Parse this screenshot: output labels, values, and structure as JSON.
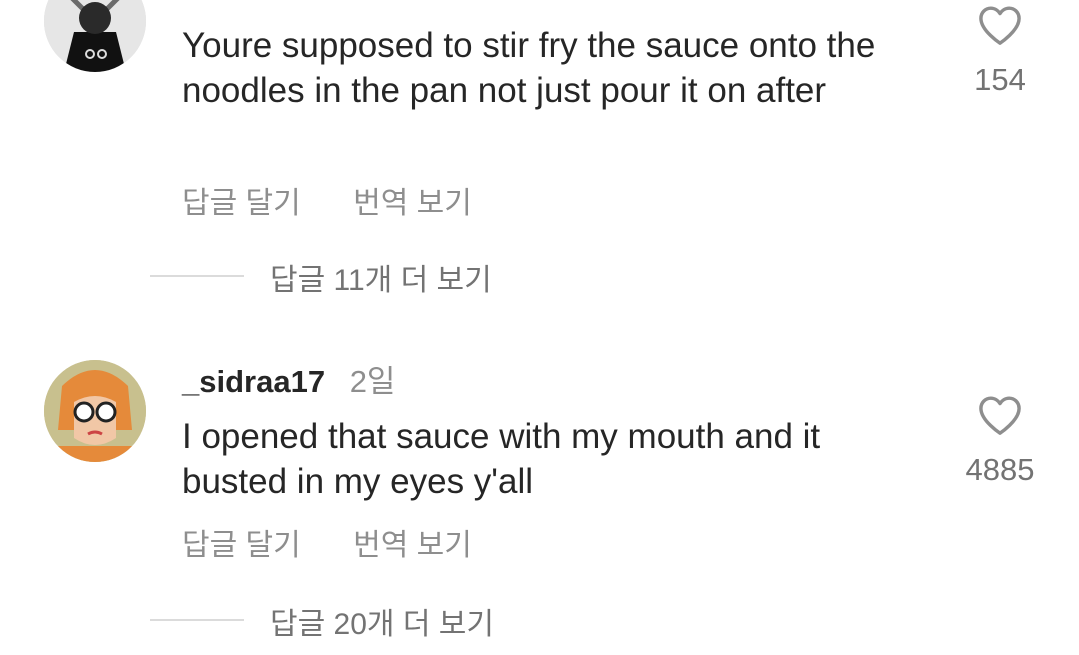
{
  "comments": [
    {
      "username": "",
      "time": "",
      "text": "Youre supposed to stir fry the sauce onto the noodles in the pan not just pour it on after",
      "likes": "154",
      "reply_label": "답글 달기",
      "translate_label": "번역 보기",
      "more_replies_label": "답글 11개 더 보기"
    },
    {
      "username": "_sidraa17",
      "time": "2일",
      "text": "I opened that sauce with my mouth and it busted in my eyes y'all",
      "likes": "4885",
      "reply_label": "답글 달기",
      "translate_label": "번역 보기",
      "more_replies_label": "답글 20개 더 보기"
    }
  ],
  "icons": {
    "like": "heart-outline-icon"
  },
  "colors": {
    "primary_text": "#262626",
    "secondary_text": "#8e8e8e",
    "divider": "#dbdbdb"
  }
}
